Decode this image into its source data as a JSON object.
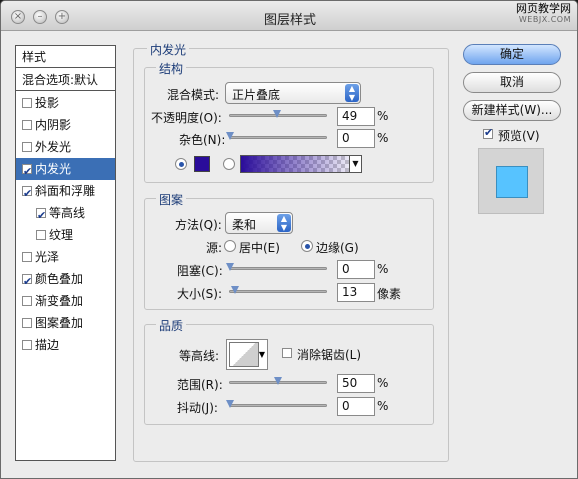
{
  "window": {
    "title": "图层样式"
  },
  "watermark": {
    "line1": "网页教学网",
    "line2": "WEBJX.COM"
  },
  "left_panel": {
    "header": "样式",
    "blend": "混合选项:默认",
    "items": [
      {
        "label": "投影",
        "checked": false
      },
      {
        "label": "内阴影",
        "checked": false
      },
      {
        "label": "外发光",
        "checked": false
      },
      {
        "label": "内发光",
        "checked": true,
        "selected": true
      },
      {
        "label": "斜面和浮雕",
        "checked": true
      },
      {
        "label": "等高线",
        "checked": true
      },
      {
        "label": "纹理",
        "checked": false
      },
      {
        "label": "光泽",
        "checked": false
      },
      {
        "label": "颜色叠加",
        "checked": true
      },
      {
        "label": "渐变叠加",
        "checked": false
      },
      {
        "label": "图案叠加",
        "checked": false
      },
      {
        "label": "描边",
        "checked": false
      }
    ]
  },
  "panel": {
    "title": "内发光",
    "structure": {
      "label": "结构",
      "blend_mode_label": "混合模式:",
      "blend_mode_value": "正片叠底",
      "opacity_label": "不透明度(O):",
      "opacity_value": "49",
      "opacity_level": 49,
      "noise_label": "杂色(N):",
      "noise_value": "0",
      "noise_level": 0,
      "unit_percent": "%",
      "glow_color": "#2a0c9a"
    },
    "elements": {
      "label": "图案",
      "method_label": "方法(Q):",
      "method_value": "柔和",
      "source_label": "源:",
      "source_center": "居中(E)",
      "source_edge": "边缘(G)",
      "choke_label": "阻塞(C):",
      "choke_value": "0",
      "choke_level": 0,
      "size_label": "大小(S):",
      "size_value": "13",
      "size_unit": "像素",
      "size_level": 5
    },
    "quality": {
      "label": "品质",
      "contour_label": "等高线:",
      "antialias_label": "消除锯齿(L)",
      "range_label": "范围(R):",
      "range_value": "50",
      "range_level": 50,
      "jitter_label": "抖动(J):",
      "jitter_value": "0",
      "jitter_level": 0
    }
  },
  "buttons": {
    "ok": "确定",
    "cancel": "取消",
    "new_style": "新建样式(W)...",
    "preview_label": "预览(V)"
  },
  "colors": {
    "preview_fill": "#57c3ff",
    "selection": "#3b6fb5"
  }
}
